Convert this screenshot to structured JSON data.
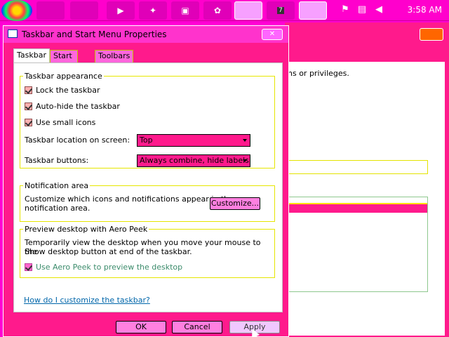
{
  "taskbar": {
    "clock": "3:58 AM",
    "pinned_icons": [
      "colorful-icon",
      "media-player-icon",
      "settings-icon",
      "folder-icon",
      "gear-icon"
    ],
    "tray_icons": [
      "flag-icon",
      "network-icon",
      "volume-icon"
    ]
  },
  "background_window": {
    "visible_text": "ns or privileges."
  },
  "dialog": {
    "title": "Taskbar and Start Menu Properties",
    "tabs": [
      {
        "label": "Taskbar",
        "selected": true
      },
      {
        "label": "Start Menu",
        "selected": false
      },
      {
        "label": "Toolbars",
        "selected": false
      }
    ],
    "appearance": {
      "title": "Taskbar appearance",
      "lock_label": "Lock the taskbar",
      "autohide_label": "Auto-hide the taskbar",
      "small_icons_label": "Use small icons",
      "location_label": "Taskbar location on screen:",
      "location_value": "Top",
      "buttons_label": "Taskbar buttons:",
      "buttons_value": "Always combine, hide labels"
    },
    "notification": {
      "title": "Notification area",
      "text_line1": "Customize which icons and notifications appear in the",
      "text_line2": "notification area.",
      "customize_button": "Customize..."
    },
    "peek": {
      "title": "Preview desktop with Aero Peek",
      "text_line1": "Temporarily view the desktop when you move your mouse to the",
      "text_line2": "Show desktop button at end of the taskbar.",
      "aero_label": "Use Aero Peek to preview the desktop"
    },
    "help_link": "How do I customize the taskbar?",
    "buttons": {
      "ok": "OK",
      "cancel": "Cancel",
      "apply": "Apply"
    }
  }
}
